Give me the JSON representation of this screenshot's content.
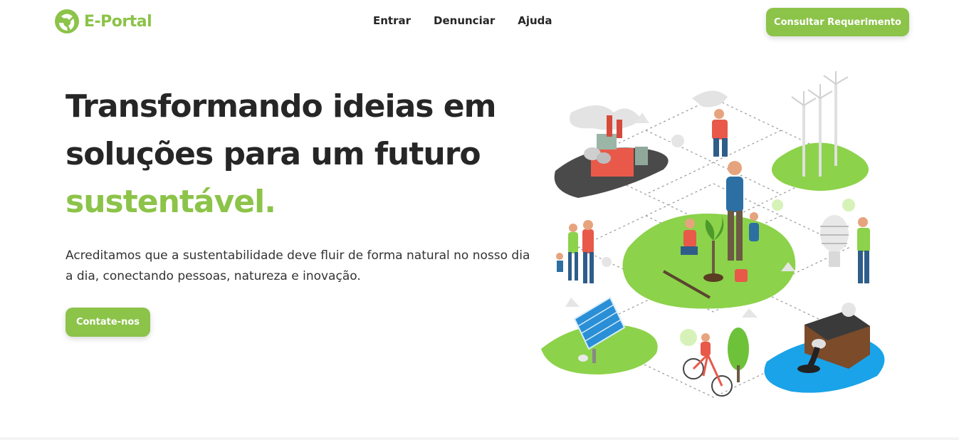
{
  "brand": {
    "name": "E-Portal",
    "color": "#8cc349"
  },
  "nav": {
    "items": [
      "Entrar",
      "Denunciar",
      "Ajuda"
    ],
    "cta": "Consultar Requerimento"
  },
  "hero": {
    "title_line1": "Transformando ideias em",
    "title_line2": "soluções para um futuro",
    "title_accent": "sustentável.",
    "subtitle": "Acreditamos que a sustentabilidade deve fluir de forma natural no nosso dia a dia, conectando pessoas, natureza e inovação.",
    "cta": "Contate-nos"
  },
  "illustration": {
    "icon": "sustainability-isometric-illustration"
  },
  "colors": {
    "accent": "#8cc349",
    "text": "#262626",
    "water": "#1aa3e8"
  }
}
